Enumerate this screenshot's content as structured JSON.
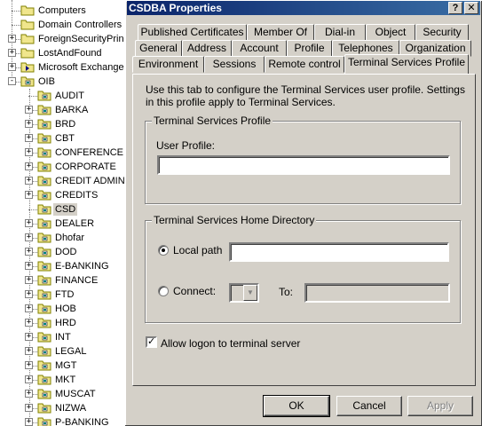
{
  "tree": {
    "items": [
      {
        "label": "Computers",
        "expander": "",
        "selected": false
      },
      {
        "label": "Domain Controllers",
        "expander": "",
        "selected": false
      },
      {
        "label": "ForeignSecurityPrin",
        "expander": "+",
        "selected": false
      },
      {
        "label": "LostAndFound",
        "expander": "+",
        "selected": false
      },
      {
        "label": "Microsoft Exchange",
        "expander": "+",
        "selected": false
      },
      {
        "label": "OIB",
        "expander": "-",
        "selected": false
      },
      {
        "label": "AUDIT",
        "expander": "",
        "selected": false
      },
      {
        "label": "BARKA",
        "expander": "+",
        "selected": false
      },
      {
        "label": "BRD",
        "expander": "+",
        "selected": false
      },
      {
        "label": "CBT",
        "expander": "+",
        "selected": false
      },
      {
        "label": "CONFERENCE R",
        "expander": "+",
        "selected": false
      },
      {
        "label": "CORPORATE",
        "expander": "+",
        "selected": false
      },
      {
        "label": "CREDIT ADMIN",
        "expander": "+",
        "selected": false
      },
      {
        "label": "CREDITS",
        "expander": "+",
        "selected": false
      },
      {
        "label": "CSD",
        "expander": "",
        "selected": true
      },
      {
        "label": "DEALER",
        "expander": "+",
        "selected": false
      },
      {
        "label": "Dhofar",
        "expander": "+",
        "selected": false
      },
      {
        "label": "DOD",
        "expander": "+",
        "selected": false
      },
      {
        "label": "E-BANKING",
        "expander": "+",
        "selected": false
      },
      {
        "label": "FINANCE",
        "expander": "+",
        "selected": false
      },
      {
        "label": "FTD",
        "expander": "+",
        "selected": false
      },
      {
        "label": "HOB",
        "expander": "+",
        "selected": false
      },
      {
        "label": "HRD",
        "expander": "+",
        "selected": false
      },
      {
        "label": "INT",
        "expander": "+",
        "selected": false
      },
      {
        "label": "LEGAL",
        "expander": "+",
        "selected": false
      },
      {
        "label": "MGT",
        "expander": "+",
        "selected": false
      },
      {
        "label": "MKT",
        "expander": "+",
        "selected": false
      },
      {
        "label": "MUSCAT",
        "expander": "+",
        "selected": false
      },
      {
        "label": "NIZWA",
        "expander": "+",
        "selected": false
      },
      {
        "label": "P-BANKING",
        "expander": "+",
        "selected": false
      }
    ]
  },
  "dialog": {
    "title": "CSDBA Properties",
    "help_button": "?",
    "close_button": "✕",
    "tabs_row1": [
      "Published Certificates",
      "Member Of",
      "Dial-in",
      "Object",
      "Security"
    ],
    "tabs_row2": [
      "General",
      "Address",
      "Account",
      "Profile",
      "Telephones",
      "Organization"
    ],
    "tabs_row3": [
      "Environment",
      "Sessions",
      "Remote control",
      "Terminal Services Profile"
    ],
    "intro": "Use this tab to configure the Terminal Services user profile. Settings in this profile apply to Terminal Services.",
    "profile_group": {
      "title": "Terminal Services Profile",
      "user_profile_label": "User Profile:",
      "user_profile_value": ""
    },
    "home_group": {
      "title": "Terminal Services Home Directory",
      "local_path_label": "Local path",
      "local_path_value": "",
      "connect_label": "Connect:",
      "to_label": "To:",
      "to_value": "",
      "selected": "local_path"
    },
    "allow_logon_label": "Allow logon to terminal server",
    "allow_logon_checked": true,
    "buttons": {
      "ok": "OK",
      "cancel": "Cancel",
      "apply": "Apply"
    }
  },
  "icons": {
    "folder": "folder-icon",
    "ou_folder": "ou-folder-icon",
    "exchange": "exchange-folder-icon",
    "checkmark": "✓"
  },
  "colors": {
    "titlebar": "#0a246a",
    "face": "#d4d0c8"
  }
}
